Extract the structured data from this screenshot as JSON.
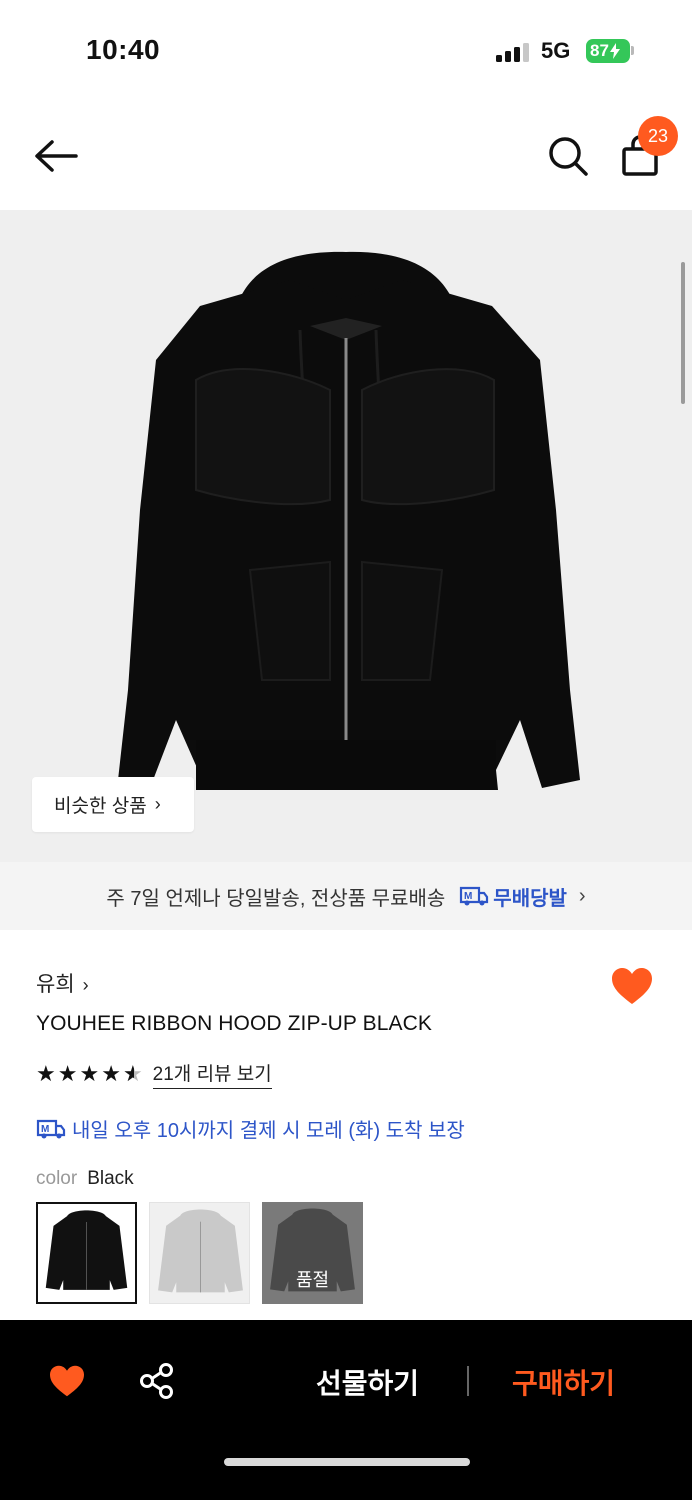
{
  "status_bar": {
    "time": "10:40",
    "network": "5G",
    "battery": "87"
  },
  "nav": {
    "cart_count": "23"
  },
  "hero": {
    "similar_label": "비슷한 상품"
  },
  "delivery_banner": {
    "text": "주 7일 언제나 당일발송, 전상품 무료배송",
    "brand": "무배당발",
    "logo_letter": "M"
  },
  "product": {
    "brand": "유희",
    "title": "YOUHEE RIBBON HOOD ZIP-UP BLACK",
    "rating": 4.5,
    "review_link": "21개 리뷰 보기",
    "arrival_text": "내일 오후 10시까지 결제 시 모레 (화) 도착 보장",
    "liked": true
  },
  "color": {
    "label": "color",
    "selected": "Black",
    "options": [
      {
        "color": "#111111",
        "selected": true,
        "sold_out": false
      },
      {
        "color": "#c9c9c9",
        "selected": false,
        "sold_out": false
      },
      {
        "color": "#555555",
        "selected": false,
        "sold_out": true,
        "sold_out_label": "품절"
      }
    ]
  },
  "bottom_bar": {
    "gift_label": "선물하기",
    "buy_label": "구매하기"
  },
  "colors": {
    "accent": "#ff5a1f",
    "link_blue": "#2d55c8",
    "battery_green": "#34c759"
  }
}
